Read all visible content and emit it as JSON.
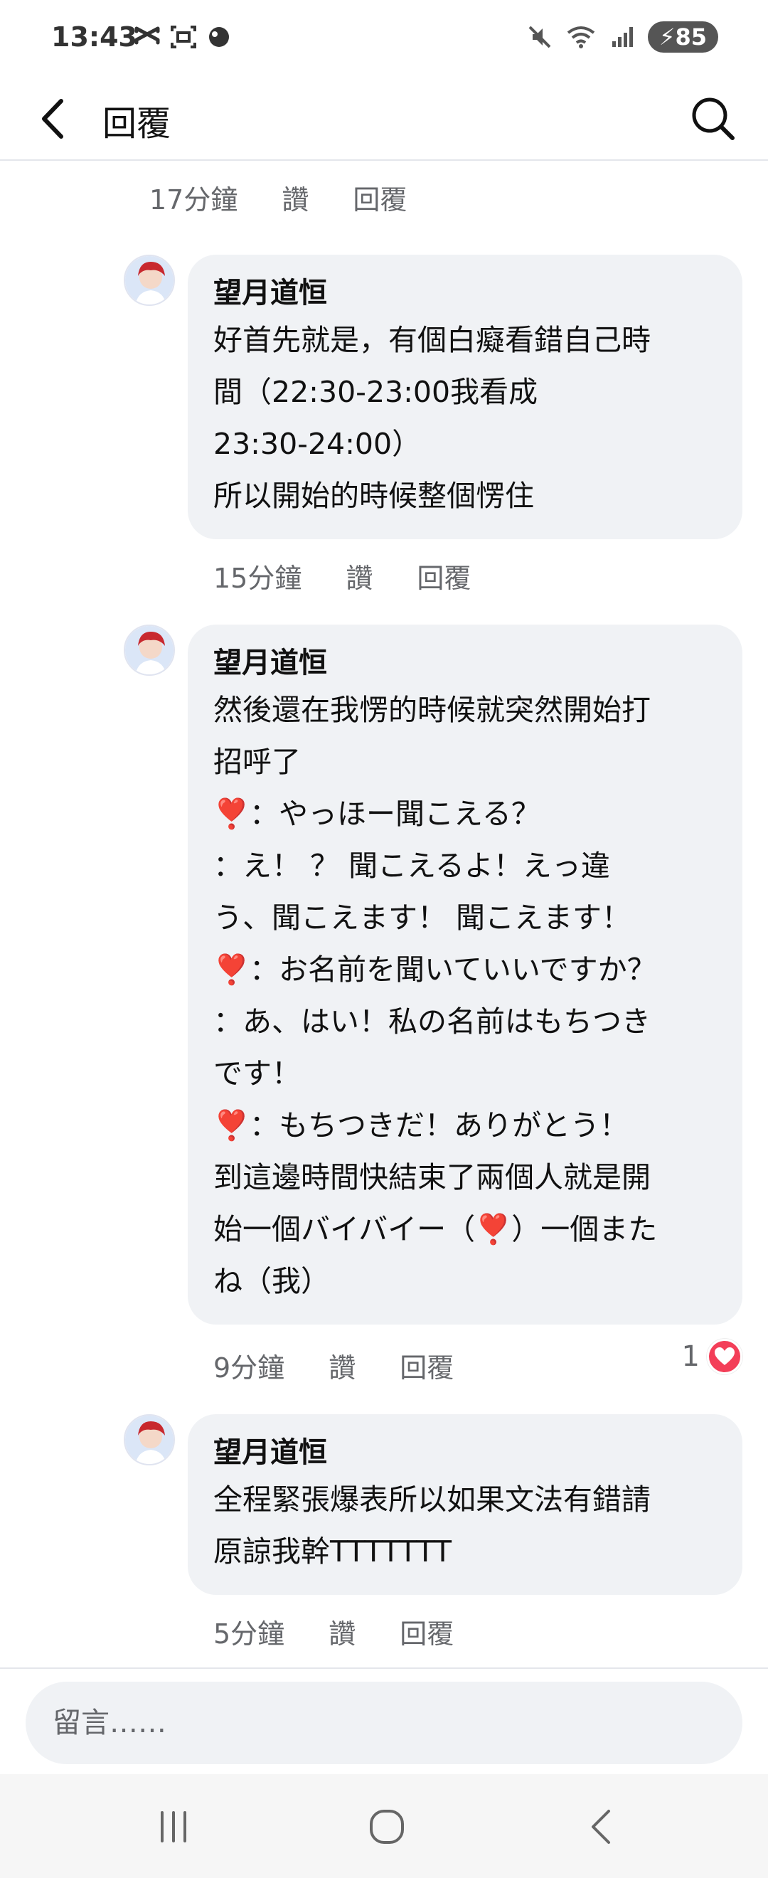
{
  "status_bar": {
    "time": "13:43",
    "battery": "85",
    "icons_left": [
      "capcut-icon",
      "screenshot-icon",
      "app-icon"
    ],
    "icons_right": [
      "mute-icon",
      "wifi-icon",
      "signal-icon",
      "battery-icon"
    ]
  },
  "header": {
    "title": "回覆"
  },
  "comments": [
    {
      "meta": {
        "time": "17分鐘",
        "like": "讚",
        "reply": "回覆"
      }
    },
    {
      "name": "望月道恒",
      "lines": [
        "好首先就是，有個白癡看錯自己時",
        "間（22:30-23:00我看成",
        "23:30-24:00）",
        "所以開始的時候整個愣住"
      ],
      "meta": {
        "time": "15分鐘",
        "like": "讚",
        "reply": "回覆"
      }
    },
    {
      "name": "望月道恒",
      "lines": [
        "然後還在我愣的時候就突然開始打",
        "招呼了",
        "❣️：やっほー聞こえる？",
        "：え！ ？ 聞こえるよ！えっ違",
        "う、聞こえます！ 聞こえます！",
        "❣️：お名前を聞いていいですか？",
        "：あ、はい！私の名前はもちつき",
        "です！",
        "❣️：もちつきだ！ありがとう！",
        "到這邊時間快結束了兩個人就是開",
        "始一個バイバイー（❣️）一個また",
        "ね（我）"
      ],
      "meta": {
        "time": "9分鐘",
        "like": "讚",
        "reply": "回覆"
      },
      "reaction_count": "1"
    },
    {
      "name": "望月道恒",
      "lines": [
        "全程緊張爆表所以如果文法有錯請",
        "原諒我幹TTTTTTT"
      ],
      "meta": {
        "time": "5分鐘",
        "like": "讚",
        "reply": "回覆"
      }
    }
  ],
  "composer": {
    "placeholder": "留言……"
  },
  "colors": {
    "bubble": "#f0f2f5",
    "meta_text": "#65676b",
    "heart": "#f33e58"
  }
}
